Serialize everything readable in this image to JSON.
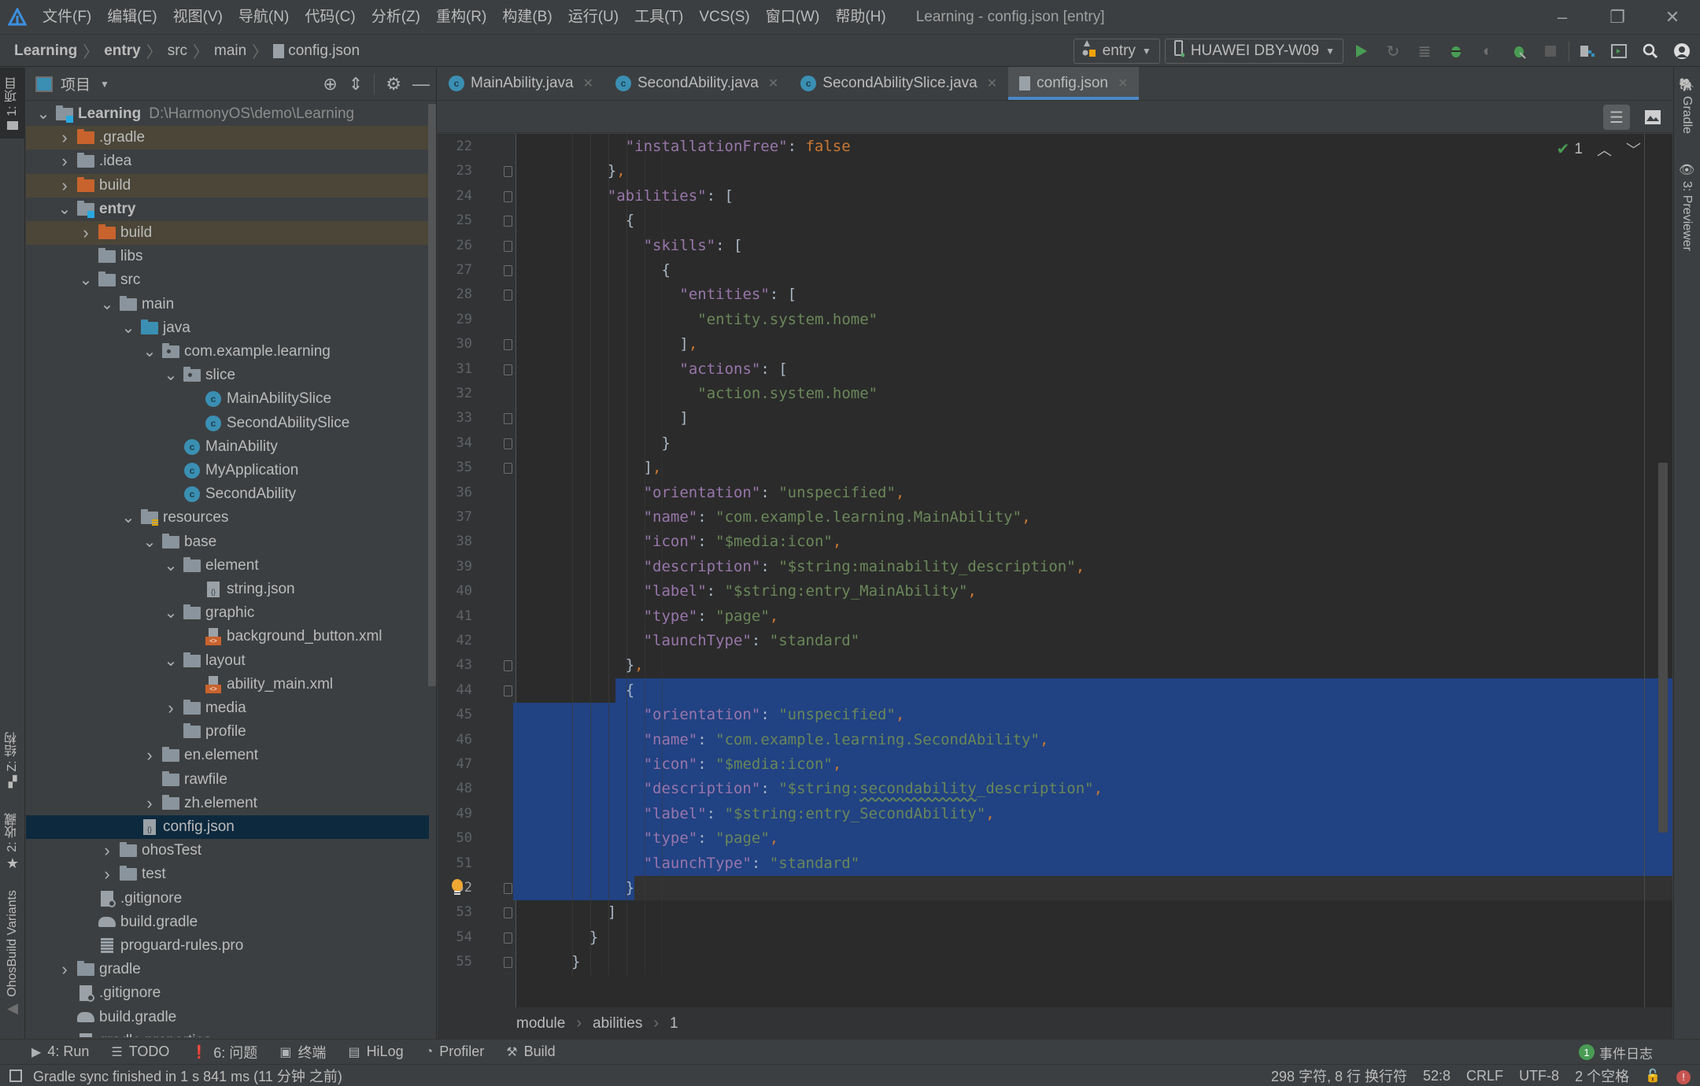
{
  "titlebar": {
    "menu": [
      "文件(F)",
      "编辑(E)",
      "视图(V)",
      "导航(N)",
      "代码(C)",
      "分析(Z)",
      "重构(R)",
      "构建(B)",
      "运行(U)",
      "工具(T)",
      "VCS(S)",
      "窗口(W)",
      "帮助(H)"
    ],
    "window_title": "Learning - config.json [entry]",
    "controls": {
      "minimize": "–",
      "restore": "❐",
      "close": "✕"
    }
  },
  "navbar": {
    "breadcrumb": [
      "Learning",
      "entry",
      "src",
      "main",
      "config.json"
    ],
    "module_selector": "entry",
    "device_selector": "HUAWEI DBY-W09",
    "toolbar_icons": [
      "run-icon",
      "apply-changes-icon",
      "apply-code-changes-icon",
      "debug-icon",
      "attach-debugger-icon",
      "profile-icon",
      "stop-icon",
      "project-structure-icon",
      "device-manager-icon",
      "search-icon",
      "account-icon"
    ]
  },
  "left_strip": {
    "tabs": [
      {
        "label": "1: 项目",
        "icon": "folder-icon",
        "active": true
      },
      {
        "label": "Z: 结构",
        "icon": "structure-icon",
        "active": false
      },
      {
        "label": "2: 收藏",
        "icon": "star-icon",
        "active": false
      },
      {
        "label": "OhosBuild Variants",
        "icon": "build-variants-icon",
        "active": false
      }
    ]
  },
  "project_panel": {
    "title": "项目",
    "header_icons": [
      "locate-icon",
      "collapse-all-icon",
      "gear-icon",
      "minimize-icon"
    ],
    "tree": [
      {
        "label": "Learning",
        "path": "D:\\HarmonyOS\\demo\\Learning",
        "depth": 0,
        "expander": "open",
        "icon": "module",
        "bold": true
      },
      {
        "label": ".gradle",
        "depth": 1,
        "expander": "closed",
        "icon": "folder-orange",
        "excluded": true
      },
      {
        "label": ".idea",
        "depth": 1,
        "expander": "closed",
        "icon": "folder"
      },
      {
        "label": "build",
        "depth": 1,
        "expander": "closed",
        "icon": "folder-orange",
        "excluded": true
      },
      {
        "label": "entry",
        "depth": 1,
        "expander": "open",
        "icon": "module",
        "bold": true
      },
      {
        "label": "build",
        "depth": 2,
        "expander": "closed",
        "icon": "folder-orange",
        "excluded": true
      },
      {
        "label": "libs",
        "depth": 2,
        "expander": "none",
        "icon": "folder"
      },
      {
        "label": "src",
        "depth": 2,
        "expander": "open",
        "icon": "folder"
      },
      {
        "label": "main",
        "depth": 3,
        "expander": "open",
        "icon": "folder"
      },
      {
        "label": "java",
        "depth": 4,
        "expander": "open",
        "icon": "folder-blue"
      },
      {
        "label": "com.example.learning",
        "depth": 5,
        "expander": "open",
        "icon": "package"
      },
      {
        "label": "slice",
        "depth": 6,
        "expander": "open",
        "icon": "package"
      },
      {
        "label": "MainAbilitySlice",
        "depth": 7,
        "expander": "none",
        "icon": "class"
      },
      {
        "label": "SecondAbilitySlice",
        "depth": 7,
        "expander": "none",
        "icon": "class"
      },
      {
        "label": "MainAbility",
        "depth": 6,
        "expander": "none",
        "icon": "class"
      },
      {
        "label": "MyApplication",
        "depth": 6,
        "expander": "none",
        "icon": "class"
      },
      {
        "label": "SecondAbility",
        "depth": 6,
        "expander": "none",
        "icon": "class"
      },
      {
        "label": "resources",
        "depth": 4,
        "expander": "open",
        "icon": "resources"
      },
      {
        "label": "base",
        "depth": 5,
        "expander": "open",
        "icon": "folder"
      },
      {
        "label": "element",
        "depth": 6,
        "expander": "open",
        "icon": "folder"
      },
      {
        "label": "string.json",
        "depth": 7,
        "expander": "none",
        "icon": "json"
      },
      {
        "label": "graphic",
        "depth": 6,
        "expander": "open",
        "icon": "folder"
      },
      {
        "label": "background_button.xml",
        "depth": 7,
        "expander": "none",
        "icon": "xml"
      },
      {
        "label": "layout",
        "depth": 6,
        "expander": "open",
        "icon": "folder"
      },
      {
        "label": "ability_main.xml",
        "depth": 7,
        "expander": "none",
        "icon": "xml"
      },
      {
        "label": "media",
        "depth": 6,
        "expander": "closed",
        "icon": "folder"
      },
      {
        "label": "profile",
        "depth": 6,
        "expander": "none",
        "icon": "folder"
      },
      {
        "label": "en.element",
        "depth": 5,
        "expander": "closed",
        "icon": "folder"
      },
      {
        "label": "rawfile",
        "depth": 5,
        "expander": "none",
        "icon": "folder"
      },
      {
        "label": "zh.element",
        "depth": 5,
        "expander": "closed",
        "icon": "folder"
      },
      {
        "label": "config.json",
        "depth": 4,
        "expander": "none",
        "icon": "json",
        "selected": true
      },
      {
        "label": "ohosTest",
        "depth": 3,
        "expander": "closed",
        "icon": "folder"
      },
      {
        "label": "test",
        "depth": 3,
        "expander": "closed",
        "icon": "folder"
      },
      {
        "label": ".gitignore",
        "depth": 2,
        "expander": "none",
        "icon": "ignore"
      },
      {
        "label": "build.gradle",
        "depth": 2,
        "expander": "none",
        "icon": "gradle"
      },
      {
        "label": "proguard-rules.pro",
        "depth": 2,
        "expander": "none",
        "icon": "text"
      },
      {
        "label": "gradle",
        "depth": 1,
        "expander": "closed",
        "icon": "folder"
      },
      {
        "label": ".gitignore",
        "depth": 1,
        "expander": "none",
        "icon": "ignore"
      },
      {
        "label": "build.gradle",
        "depth": 1,
        "expander": "none",
        "icon": "gradle"
      },
      {
        "label": "gradle.properties",
        "depth": 1,
        "expander": "none",
        "icon": "properties"
      }
    ]
  },
  "editor": {
    "tabs": [
      {
        "label": "MainAbility.java",
        "icon": "class",
        "active": false
      },
      {
        "label": "SecondAbility.java",
        "icon": "class",
        "active": false
      },
      {
        "label": "SecondAbilitySlice.java",
        "icon": "class",
        "active": false
      },
      {
        "label": "config.json",
        "icon": "json",
        "active": true
      }
    ],
    "view_modes": [
      "editor-only-icon",
      "preview-icon"
    ],
    "inspection": {
      "count": "1"
    },
    "current_line": 52,
    "selection": {
      "from_line": 44,
      "to_line": 52
    },
    "lines": [
      {
        "n": 22,
        "indent": 3,
        "tokens": [
          [
            "k",
            "\"installationFree\""
          ],
          [
            "pu",
            ": "
          ],
          [
            "b",
            "false"
          ]
        ]
      },
      {
        "n": 23,
        "indent": 2,
        "fold": true,
        "tokens": [
          [
            "pu",
            "}"
          ],
          [
            "p",
            ","
          ]
        ]
      },
      {
        "n": 24,
        "indent": 2,
        "fold": true,
        "tokens": [
          [
            "k",
            "\"abilities\""
          ],
          [
            "pu",
            ": ["
          ]
        ]
      },
      {
        "n": 25,
        "indent": 3,
        "fold": true,
        "tokens": [
          [
            "pu",
            "{"
          ]
        ]
      },
      {
        "n": 26,
        "indent": 4,
        "fold": true,
        "tokens": [
          [
            "k",
            "\"skills\""
          ],
          [
            "pu",
            ": ["
          ]
        ]
      },
      {
        "n": 27,
        "indent": 5,
        "fold": true,
        "tokens": [
          [
            "pu",
            "{"
          ]
        ]
      },
      {
        "n": 28,
        "indent": 6,
        "fold": true,
        "tokens": [
          [
            "k",
            "\"entities\""
          ],
          [
            "pu",
            ": ["
          ]
        ]
      },
      {
        "n": 29,
        "indent": 7,
        "tokens": [
          [
            "s",
            "\"entity.system.home\""
          ]
        ]
      },
      {
        "n": 30,
        "indent": 6,
        "fold": true,
        "tokens": [
          [
            "pu",
            "]"
          ],
          [
            "p",
            ","
          ]
        ]
      },
      {
        "n": 31,
        "indent": 6,
        "fold": true,
        "tokens": [
          [
            "k",
            "\"actions\""
          ],
          [
            "pu",
            ": ["
          ]
        ]
      },
      {
        "n": 32,
        "indent": 7,
        "tokens": [
          [
            "s",
            "\"action.system.home\""
          ]
        ]
      },
      {
        "n": 33,
        "indent": 6,
        "fold": true,
        "tokens": [
          [
            "pu",
            "]"
          ]
        ]
      },
      {
        "n": 34,
        "indent": 5,
        "fold": true,
        "tokens": [
          [
            "pu",
            "}"
          ]
        ]
      },
      {
        "n": 35,
        "indent": 4,
        "fold": true,
        "tokens": [
          [
            "pu",
            "]"
          ],
          [
            "p",
            ","
          ]
        ]
      },
      {
        "n": 36,
        "indent": 4,
        "tokens": [
          [
            "k",
            "\"orientation\""
          ],
          [
            "pu",
            ": "
          ],
          [
            "s",
            "\"unspecified\""
          ],
          [
            "p",
            ","
          ]
        ]
      },
      {
        "n": 37,
        "indent": 4,
        "tokens": [
          [
            "k",
            "\"name\""
          ],
          [
            "pu",
            ": "
          ],
          [
            "s",
            "\"com.example.learning.MainAbility\""
          ],
          [
            "p",
            ","
          ]
        ]
      },
      {
        "n": 38,
        "indent": 4,
        "tokens": [
          [
            "k",
            "\"icon\""
          ],
          [
            "pu",
            ": "
          ],
          [
            "s",
            "\"$media:icon\""
          ],
          [
            "p",
            ","
          ]
        ]
      },
      {
        "n": 39,
        "indent": 4,
        "tokens": [
          [
            "k",
            "\"description\""
          ],
          [
            "pu",
            ": "
          ],
          [
            "s",
            "\"$string:mainability_description\""
          ],
          [
            "p",
            ","
          ]
        ]
      },
      {
        "n": 40,
        "indent": 4,
        "tokens": [
          [
            "k",
            "\"label\""
          ],
          [
            "pu",
            ": "
          ],
          [
            "s",
            "\"$string:entry_MainAbility\""
          ],
          [
            "p",
            ","
          ]
        ]
      },
      {
        "n": 41,
        "indent": 4,
        "tokens": [
          [
            "k",
            "\"type\""
          ],
          [
            "pu",
            ": "
          ],
          [
            "s",
            "\"page\""
          ],
          [
            "p",
            ","
          ]
        ]
      },
      {
        "n": 42,
        "indent": 4,
        "tokens": [
          [
            "k",
            "\"launchType\""
          ],
          [
            "pu",
            ": "
          ],
          [
            "s",
            "\"standard\""
          ]
        ]
      },
      {
        "n": 43,
        "indent": 3,
        "fold": true,
        "tokens": [
          [
            "pu",
            "}"
          ],
          [
            "p",
            ","
          ]
        ]
      },
      {
        "n": 44,
        "indent": 3,
        "fold": true,
        "tokens": [
          [
            "pu",
            "{"
          ]
        ]
      },
      {
        "n": 45,
        "indent": 4,
        "tokens": [
          [
            "k",
            "\"orientation\""
          ],
          [
            "pu",
            ": "
          ],
          [
            "s",
            "\"unspecified\""
          ],
          [
            "p",
            ","
          ]
        ]
      },
      {
        "n": 46,
        "indent": 4,
        "tokens": [
          [
            "k",
            "\"name\""
          ],
          [
            "pu",
            ": "
          ],
          [
            "s",
            "\"com.example.learning.SecondAbility\""
          ],
          [
            "p",
            ","
          ]
        ]
      },
      {
        "n": 47,
        "indent": 4,
        "tokens": [
          [
            "k",
            "\"icon\""
          ],
          [
            "pu",
            ": "
          ],
          [
            "s",
            "\"$media:icon\""
          ],
          [
            "p",
            ","
          ]
        ]
      },
      {
        "n": 48,
        "indent": 4,
        "tokens": [
          [
            "k",
            "\"description\""
          ],
          [
            "pu",
            ": "
          ],
          [
            "s",
            "\"$string:"
          ],
          [
            "s squiggle",
            "secondability"
          ],
          [
            "s",
            "_description\""
          ],
          [
            "p",
            ","
          ]
        ]
      },
      {
        "n": 49,
        "indent": 4,
        "tokens": [
          [
            "k",
            "\"label\""
          ],
          [
            "pu",
            ": "
          ],
          [
            "s",
            "\"$string:entry_SecondAbility\""
          ],
          [
            "p",
            ","
          ]
        ]
      },
      {
        "n": 50,
        "indent": 4,
        "tokens": [
          [
            "k",
            "\"type\""
          ],
          [
            "pu",
            ": "
          ],
          [
            "s",
            "\"page\""
          ],
          [
            "p",
            ","
          ]
        ]
      },
      {
        "n": 51,
        "indent": 4,
        "tokens": [
          [
            "k",
            "\"launchType\""
          ],
          [
            "pu",
            ": "
          ],
          [
            "s",
            "\"standard\""
          ]
        ]
      },
      {
        "n": 52,
        "indent": 3,
        "fold": true,
        "tokens": [
          [
            "pu",
            "}"
          ]
        ]
      },
      {
        "n": 53,
        "indent": 2,
        "fold": true,
        "tokens": [
          [
            "pu",
            "]"
          ]
        ]
      },
      {
        "n": 54,
        "indent": 1,
        "fold": true,
        "tokens": [
          [
            "pu",
            "}"
          ]
        ]
      },
      {
        "n": 55,
        "indent": 0,
        "fold": true,
        "tokens": [
          [
            "pu",
            "}"
          ]
        ]
      }
    ],
    "breadcrumb": [
      "module",
      "abilities",
      "1"
    ]
  },
  "right_strip": {
    "tabs": [
      {
        "label": "Gradle",
        "icon": "gradle-icon"
      },
      {
        "label": "3: Previewer",
        "icon": "eye-icon"
      }
    ]
  },
  "tool_windows": [
    {
      "label": "4: Run",
      "icon": "run-icon"
    },
    {
      "label": "TODO",
      "icon": "list-icon"
    },
    {
      "label": "6: 问题",
      "icon": "problems-icon"
    },
    {
      "label": "终端",
      "icon": "terminal-icon"
    },
    {
      "label": "HiLog",
      "icon": "hilog-icon"
    },
    {
      "label": "Profiler",
      "icon": "profiler-icon"
    },
    {
      "label": "Build",
      "icon": "hammer-icon"
    }
  ],
  "event_log": {
    "count": "1",
    "label": "事件日志"
  },
  "status_bar": {
    "message": "Gradle sync finished in 1 s 841 ms (11 分钟 之前)",
    "selection_info": "298 字符, 8 行 换行符",
    "caret": "52:8",
    "line_separator": "CRLF",
    "encoding": "UTF-8",
    "indent": "2 个空格"
  },
  "colors": {
    "accent": "#4a88c7",
    "selection": "#214283",
    "keyword_purple": "#9876aa",
    "string_green": "#6a8759",
    "literal_orange": "#cc7832"
  }
}
